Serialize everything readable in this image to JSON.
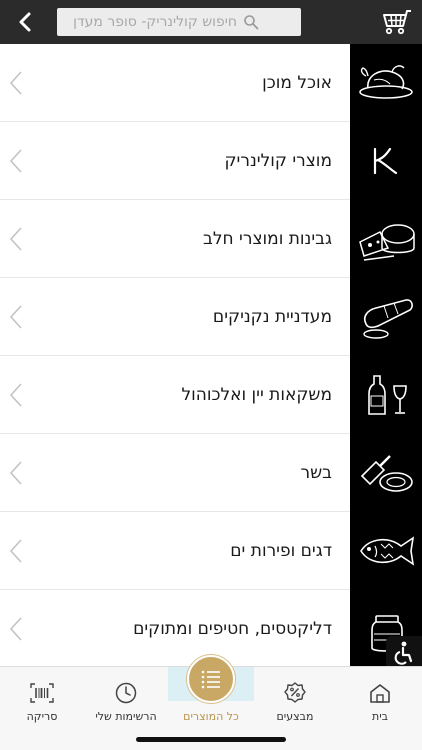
{
  "header": {
    "search_placeholder": "חיפוש קולינריק- סופר מעדן",
    "back_icon": "chevron-left-icon",
    "cart_icon": "shopping-cart-icon"
  },
  "categories": [
    {
      "label": "אוכל מוכן",
      "icon": "roast-chicken-icon"
    },
    {
      "label": "מוצרי קולינריק",
      "icon": "brand-k-icon"
    },
    {
      "label": "גבינות ומוצרי חלב",
      "icon": "cheese-icon"
    },
    {
      "label": "מעדניית נקניקים",
      "icon": "sausage-icon"
    },
    {
      "label": "משקאות יין ואלכוהול",
      "icon": "wine-icon"
    },
    {
      "label": "בשר",
      "icon": "meat-cleaver-icon"
    },
    {
      "label": "דגים ופירות ים",
      "icon": "fish-icon"
    },
    {
      "label": "דליקטסים, חטיפים ומתוקים",
      "icon": "jar-icon"
    }
  ],
  "bottom_nav": {
    "home": "בית",
    "deals": "מבצעים",
    "all_products": "כל המוצרים",
    "my_lists": "הרשימות שלי",
    "scan": "סריקה"
  },
  "colors": {
    "header_bg": "#2b2b2b",
    "accent_gold": "#c8a864",
    "active_tab_bg": "#dceff4"
  }
}
